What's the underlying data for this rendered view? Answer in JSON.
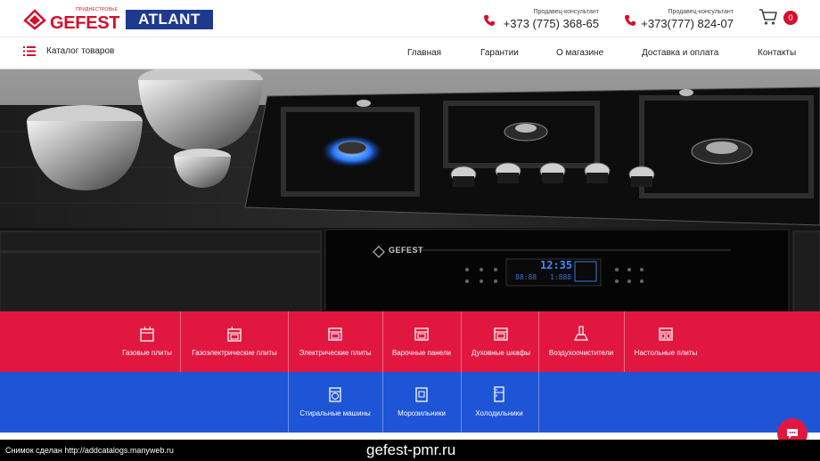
{
  "header": {
    "gefest_logo_text": "GEFEST",
    "gefest_logo_sub": "ПРИДНЕСТРОВЬЕ",
    "atlant_logo_text": "ATLANT",
    "phones": [
      {
        "caption": "Продавец-консультант",
        "number": "+373 (775) 368-65"
      },
      {
        "caption": "Продавец-консультант",
        "number": "+373(777) 824-07"
      }
    ],
    "cart_count": "0"
  },
  "nav": {
    "catalog_label": "Каталог товаров",
    "links": [
      "Главная",
      "Гарантии",
      "О магазине",
      "Доставка и оплата",
      "Контакты"
    ]
  },
  "hero": {
    "brand_text": "GEFEST",
    "display_time": "12:35",
    "display_left": "88:88",
    "display_right": "1:888"
  },
  "categories": {
    "row1": [
      {
        "label": "Газовые плиты",
        "icon": "gas-stove-icon"
      },
      {
        "label": "Газоэлектрические плиты",
        "icon": "gas-electric-stove-icon"
      },
      {
        "label": "Электрические плиты",
        "icon": "electric-stove-icon"
      },
      {
        "label": "Варочные панели",
        "icon": "hob-icon"
      },
      {
        "label": "Духовные шкафы",
        "icon": "oven-icon"
      },
      {
        "label": "Воздухоочистители",
        "icon": "hood-icon"
      },
      {
        "label": "Настольные плиты",
        "icon": "tabletop-stove-icon"
      }
    ],
    "row2": [
      {
        "label": "Стиральные машины",
        "icon": "washing-machine-icon"
      },
      {
        "label": "Морозильники",
        "icon": "freezer-icon"
      },
      {
        "label": "Холодильники",
        "icon": "fridge-icon"
      }
    ]
  },
  "footer": {
    "screenshot_note": "Снимок сделан http://addcatalogs.manyweb.ru",
    "site": "gefest-pmr.ru"
  },
  "colors": {
    "brand_red": "#e2173f",
    "brand_blue": "#1e54d6",
    "atlant_blue": "#1d3a8f"
  }
}
